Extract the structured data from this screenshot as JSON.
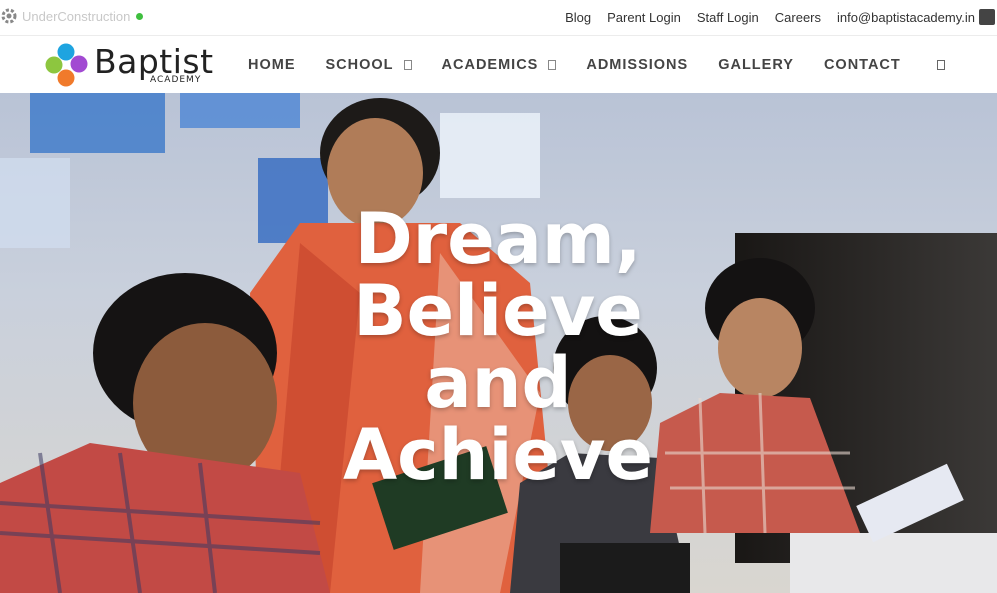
{
  "topbar": {
    "status_label": "UnderConstruction",
    "links": {
      "blog": "Blog",
      "parent_login": "Parent Login",
      "staff_login": "Staff Login",
      "careers": "Careers",
      "email": "info@baptistacademy.in"
    }
  },
  "brand": {
    "name": "Baptist",
    "sub": "ACADEMY",
    "colors": {
      "blue": "#1ea4e0",
      "purple": "#a24ad2",
      "green": "#8dc63f",
      "orange": "#f07a2b"
    }
  },
  "nav": {
    "home": "HOME",
    "school": "SCHOOL",
    "academics": "ACADEMICS",
    "admissions": "ADMISSIONS",
    "gallery": "GALLERY",
    "contact": "CONTACT"
  },
  "icons": {
    "status": "gear-icon",
    "email": "mail-icon",
    "dropdown": "chevron-down-icon",
    "search": "search-icon"
  },
  "hero": {
    "heading_lines": [
      "Dream,",
      "Believe",
      "and",
      "Achieve"
    ]
  }
}
